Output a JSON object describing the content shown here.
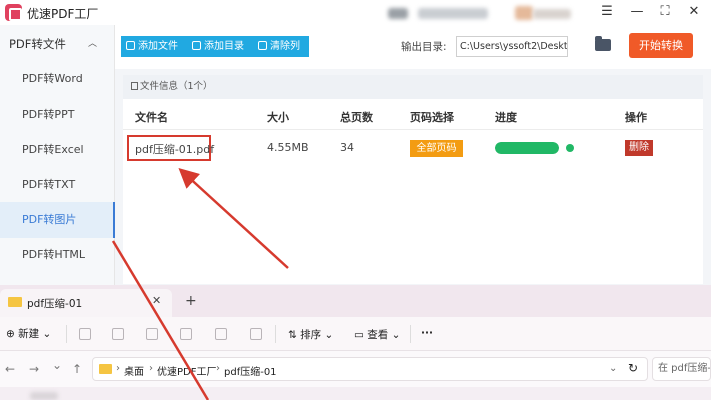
{
  "app": {
    "title": "优速PDF工厂"
  },
  "window_controls": {
    "menu": "☰",
    "minimize": "—",
    "maximize": "⛶",
    "close": "✕"
  },
  "sidebar": {
    "section": "PDF转文件",
    "items": [
      {
        "label": "PDF转Word"
      },
      {
        "label": "PDF转PPT"
      },
      {
        "label": "PDF转Excel"
      },
      {
        "label": "PDF转TXT"
      },
      {
        "label": "PDF转图片"
      },
      {
        "label": "PDF转HTML"
      }
    ],
    "active_index": 4
  },
  "toolbar": {
    "add_file": "添加文件",
    "add_folder": "添加目录",
    "clear_list": "清除列表",
    "output_label": "输出目录:",
    "output_path": "C:\\Users\\yssoft2\\Deskto",
    "start": "开始转换"
  },
  "file_info": {
    "title": "文件信息（1个）"
  },
  "table": {
    "headers": [
      "文件名",
      "大小",
      "总页数",
      "页码选择",
      "进度",
      "操作"
    ],
    "rows": [
      {
        "name": "pdf压缩-01.pdf",
        "size": "4.55MB",
        "pages": "34",
        "page_select": "全部页码",
        "progress": 1.0,
        "action": "删除"
      }
    ]
  },
  "explorer": {
    "tab_title": "pdf压缩-01",
    "tab_close": "✕",
    "new_tab": "+",
    "new_label": "新建",
    "sort_label": "排序",
    "view_label": "查看",
    "more": "···",
    "nav": {
      "back": "←",
      "forward": "→",
      "down": "⌄",
      "up": "↑"
    },
    "breadcrumb": [
      "桌面",
      "优速PDF工厂",
      "pdf压缩-01"
    ],
    "refresh": "↻",
    "search_placeholder": "在 pdf压缩-01"
  },
  "colors": {
    "accent_blue": "#21a9e1",
    "start_orange": "#f05a28",
    "badge_orange": "#f39c12",
    "progress_green": "#21b866",
    "delete_red": "#c0392b",
    "annotation_red": "#d63a2e"
  }
}
